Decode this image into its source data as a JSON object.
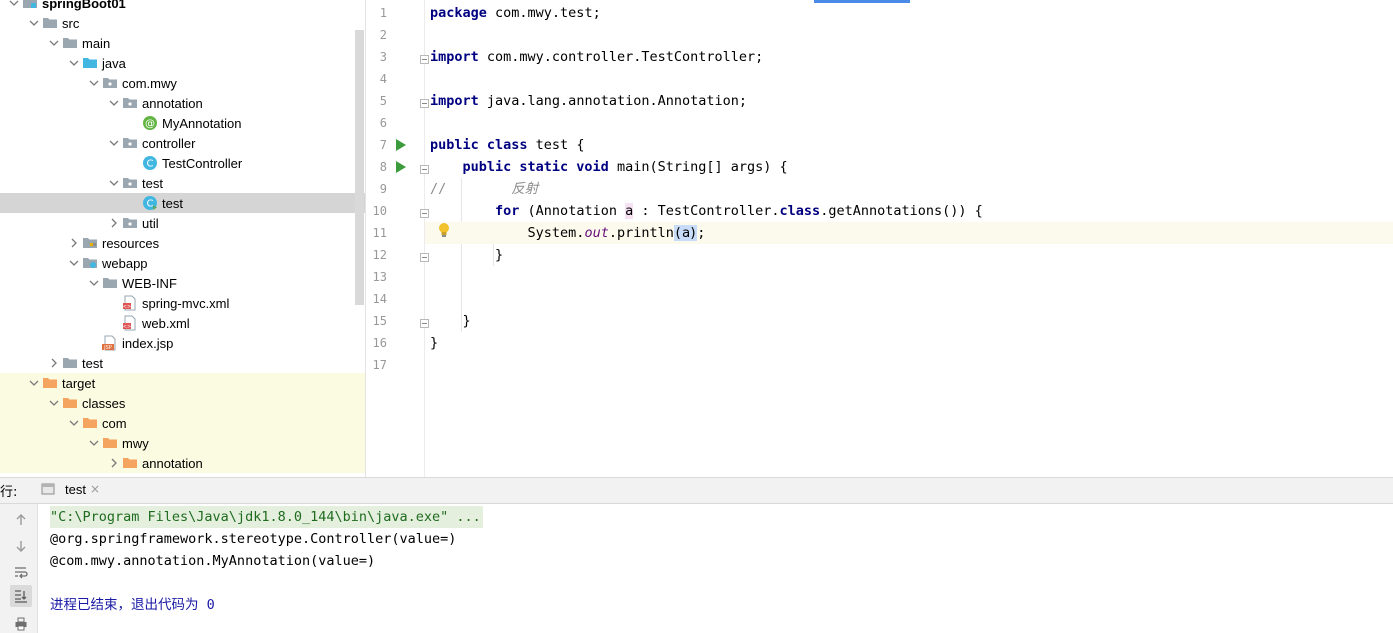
{
  "project_tree": {
    "rows": [
      {
        "label": "springBoot01",
        "depth": 0,
        "expanded": true,
        "icon": "module-icon",
        "state": ""
      },
      {
        "label": "src",
        "depth": 1,
        "expanded": true,
        "icon": "folder-icon",
        "state": ""
      },
      {
        "label": "main",
        "depth": 2,
        "expanded": true,
        "icon": "folder-icon",
        "state": ""
      },
      {
        "label": "java",
        "depth": 3,
        "expanded": true,
        "icon": "source-folder-icon",
        "state": ""
      },
      {
        "label": "com.mwy",
        "depth": 4,
        "expanded": true,
        "icon": "package-icon",
        "state": ""
      },
      {
        "label": "annotation",
        "depth": 5,
        "expanded": true,
        "icon": "package-icon",
        "state": ""
      },
      {
        "label": "MyAnnotation",
        "depth": 6,
        "expanded": null,
        "icon": "annotation-icon",
        "state": ""
      },
      {
        "label": "controller",
        "depth": 5,
        "expanded": true,
        "icon": "package-icon",
        "state": ""
      },
      {
        "label": "TestController",
        "depth": 6,
        "expanded": null,
        "icon": "class-icon",
        "state": ""
      },
      {
        "label": "test",
        "depth": 5,
        "expanded": true,
        "icon": "package-icon",
        "state": ""
      },
      {
        "label": "test",
        "depth": 6,
        "expanded": null,
        "icon": "runnable-class-icon",
        "state": "selected"
      },
      {
        "label": "util",
        "depth": 5,
        "expanded": false,
        "icon": "package-icon",
        "state": ""
      },
      {
        "label": "resources",
        "depth": 3,
        "expanded": false,
        "icon": "resources-folder-icon",
        "state": ""
      },
      {
        "label": "webapp",
        "depth": 3,
        "expanded": true,
        "icon": "web-folder-icon",
        "state": ""
      },
      {
        "label": "WEB-INF",
        "depth": 4,
        "expanded": true,
        "icon": "folder-icon",
        "state": ""
      },
      {
        "label": "spring-mvc.xml",
        "depth": 5,
        "expanded": null,
        "icon": "xml-file-icon",
        "state": ""
      },
      {
        "label": "web.xml",
        "depth": 5,
        "expanded": null,
        "icon": "xml-file-icon",
        "state": ""
      },
      {
        "label": "index.jsp",
        "depth": 4,
        "expanded": null,
        "icon": "jsp-file-icon",
        "state": ""
      },
      {
        "label": "test",
        "depth": 2,
        "expanded": false,
        "icon": "folder-icon",
        "state": ""
      },
      {
        "label": "target",
        "depth": 1,
        "expanded": true,
        "icon": "excluded-folder-icon",
        "state": "excluded"
      },
      {
        "label": "classes",
        "depth": 2,
        "expanded": true,
        "icon": "excluded-folder-icon",
        "state": "excluded"
      },
      {
        "label": "com",
        "depth": 3,
        "expanded": true,
        "icon": "excluded-folder-icon",
        "state": "excluded"
      },
      {
        "label": "mwy",
        "depth": 4,
        "expanded": true,
        "icon": "excluded-folder-icon",
        "state": "excluded"
      },
      {
        "label": "annotation",
        "depth": 5,
        "expanded": false,
        "icon": "excluded-folder-icon",
        "state": "excluded"
      }
    ]
  },
  "editor": {
    "line_numbers": [
      "1",
      "2",
      "3",
      "4",
      "5",
      "6",
      "7",
      "8",
      "9",
      "10",
      "11",
      "12",
      "13",
      "14",
      "15",
      "16",
      "17"
    ],
    "current_line": 11,
    "lines": [
      {
        "n": 1,
        "tokens": [
          {
            "t": "package",
            "c": "kw"
          },
          {
            "t": " com.mwy.test;",
            "c": ""
          }
        ]
      },
      {
        "n": 2,
        "tokens": []
      },
      {
        "n": 3,
        "tokens": [
          {
            "t": "import",
            "c": "kw"
          },
          {
            "t": " com.mwy.controller.TestController;",
            "c": ""
          }
        ]
      },
      {
        "n": 4,
        "tokens": []
      },
      {
        "n": 5,
        "tokens": [
          {
            "t": "import",
            "c": "kw"
          },
          {
            "t": " java.lang.annotation.Annotation;",
            "c": ""
          }
        ]
      },
      {
        "n": 6,
        "tokens": []
      },
      {
        "n": 7,
        "tokens": [
          {
            "t": "public class",
            "c": "kw"
          },
          {
            "t": " test {",
            "c": ""
          }
        ]
      },
      {
        "n": 8,
        "tokens": [
          {
            "t": "    ",
            "c": ""
          },
          {
            "t": "public static void",
            "c": "kw"
          },
          {
            "t": " main(String[] args) {",
            "c": ""
          }
        ]
      },
      {
        "n": 9,
        "tokens": [
          {
            "t": "//",
            "c": "cm"
          },
          {
            "t": "        反射",
            "c": "cmi"
          }
        ]
      },
      {
        "n": 10,
        "tokens": [
          {
            "t": "        ",
            "c": ""
          },
          {
            "t": "for",
            "c": "kw"
          },
          {
            "t": " (Annotation ",
            "c": ""
          },
          {
            "t": "a",
            "c": "hl-param"
          },
          {
            "t": " : TestController.",
            "c": ""
          },
          {
            "t": "class",
            "c": "kw"
          },
          {
            "t": ".getAnnotations()) {",
            "c": ""
          }
        ]
      },
      {
        "n": 11,
        "tokens": [
          {
            "t": "            System.",
            "c": ""
          },
          {
            "t": "out",
            "c": "st"
          },
          {
            "t": ".println",
            "c": ""
          },
          {
            "t": "(",
            "c": "hl-use"
          },
          {
            "t": "a",
            "c": "hl-use"
          },
          {
            "t": "CARET",
            "c": "caret"
          },
          {
            "t": ")",
            "c": "hl-use"
          },
          {
            "t": ";",
            "c": ""
          }
        ]
      },
      {
        "n": 12,
        "tokens": [
          {
            "t": "        }",
            "c": ""
          }
        ]
      },
      {
        "n": 13,
        "tokens": []
      },
      {
        "n": 14,
        "tokens": []
      },
      {
        "n": 15,
        "tokens": [
          {
            "t": "    }",
            "c": ""
          }
        ]
      },
      {
        "n": 16,
        "tokens": [
          {
            "t": "}",
            "c": ""
          }
        ]
      },
      {
        "n": 17,
        "tokens": []
      }
    ],
    "run_gutter_lines": [
      7,
      8
    ],
    "fold_lines": [
      3,
      5,
      8,
      10,
      12,
      15
    ]
  },
  "run_panel": {
    "label": "行:",
    "tab_label": "test",
    "tab_close": "×",
    "toolbar": [
      "up-arrow-icon",
      "down-arrow-icon",
      "soft-wrap-icon",
      "scroll-to-end-icon",
      "print-icon"
    ],
    "output": [
      {
        "text": "\"C:\\Program Files\\Java\\jdk1.8.0_144\\bin\\java.exe\" ...",
        "kind": "cmd"
      },
      {
        "text": "@org.springframework.stereotype.Controller(value=)",
        "kind": ""
      },
      {
        "text": "@com.mwy.annotation.MyAnnotation(value=)",
        "kind": ""
      },
      {
        "text": "",
        "kind": ""
      },
      {
        "text": "进程已结束，退出代码为 0",
        "kind": "exit"
      }
    ]
  },
  "colors": {
    "keyword": "#000080",
    "comment": "#8c8c8c",
    "static_field": "#660e7a",
    "selected_row": "#d5d5d5",
    "excluded_bg": "#fbfbe1",
    "current_line": "#fcfaed",
    "run_green": "#3c9c3c"
  }
}
